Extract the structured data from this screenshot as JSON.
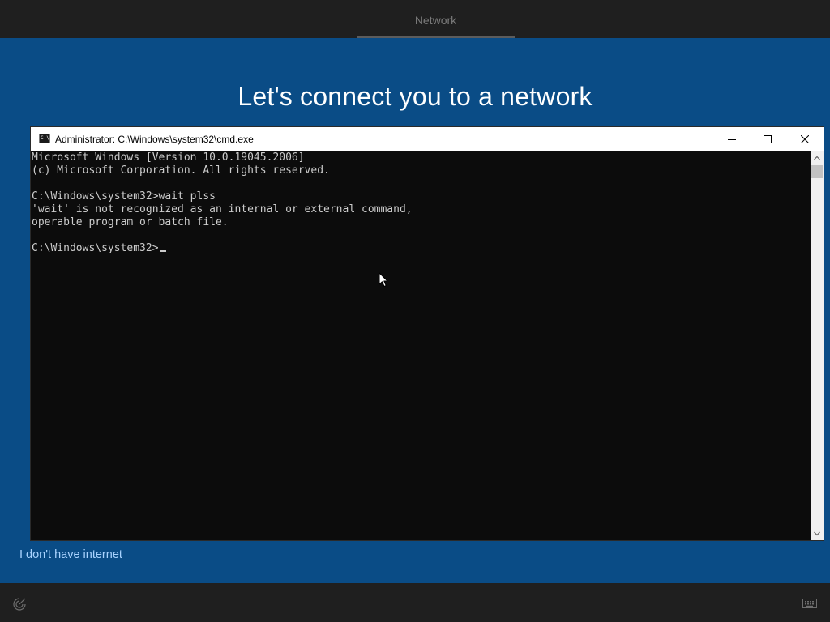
{
  "top_bar": {
    "tab_label": "Network"
  },
  "oobe": {
    "title": "Let's connect you to a network",
    "no_internet_link": "I don't have internet"
  },
  "cmd": {
    "window_title": "Administrator: C:\\Windows\\system32\\cmd.exe",
    "icon_text": "C:\\",
    "lines": [
      "Microsoft Windows [Version 10.0.19045.2006]",
      "(c) Microsoft Corporation. All rights reserved.",
      "",
      "C:\\Windows\\system32>wait plss",
      "'wait' is not recognized as an internal or external command,",
      "operable program or batch file.",
      "",
      "C:\\Windows\\system32>"
    ]
  },
  "icons": {
    "minimize": "minimize-icon",
    "maximize": "maximize-icon",
    "close": "close-icon",
    "ease_of_access": "ease-of-access-icon",
    "keyboard": "keyboard-icon",
    "pointer": "mouse-pointer-icon"
  },
  "colors": {
    "oobe_blue": "#0a4c86",
    "bar_dark": "#1f1f1f",
    "console_bg": "#0c0c0c",
    "console_text": "#cccccc",
    "link": "#a9d3ff"
  }
}
